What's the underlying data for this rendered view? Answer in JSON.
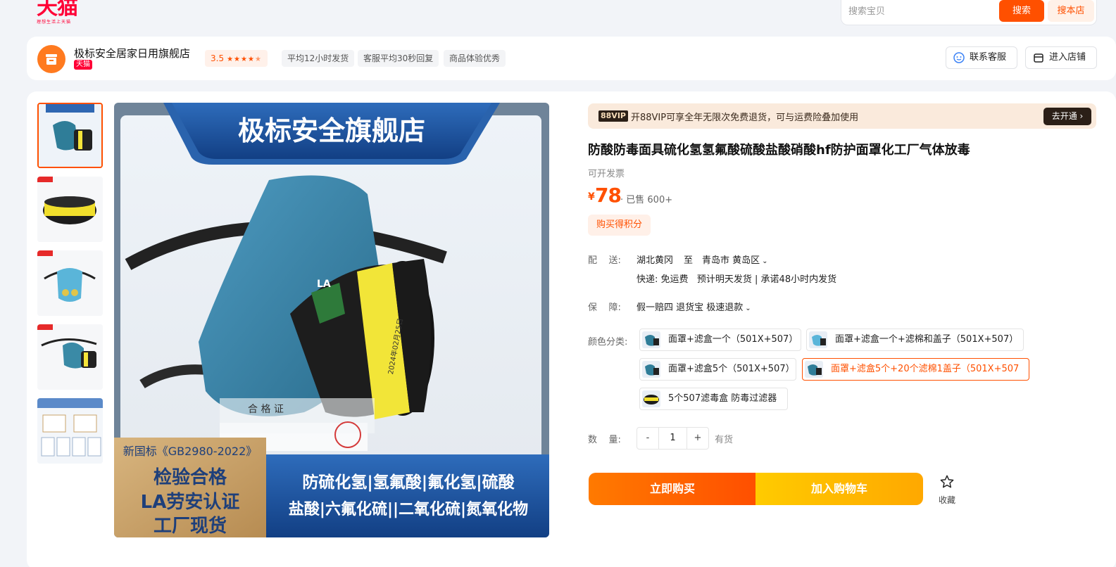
{
  "brand": {
    "logo_text": "天猫",
    "logo_slogan": "理想生活上天猫"
  },
  "search": {
    "placeholder": "搜索宝贝",
    "search_label": "搜索",
    "store_search_label": "搜本店"
  },
  "store": {
    "name": "极标安全居家日用旗舰店",
    "tag": "天猫",
    "rating": "3.5",
    "rating_stars": 3.5,
    "chips": [
      "平均12小时发货",
      "客服平均30秒回复",
      "商品体验优秀"
    ],
    "contact_label": "联系客服",
    "enter_label": "进入店铺"
  },
  "gallery": {
    "main_banner_title": "极标安全旗舰店",
    "badge_line1": "新国标《GB2980-2022》",
    "badge_line2": "检验合格",
    "badge_line3": "LA劳安认证",
    "badge_line4": "工厂现货",
    "footer_line1": "防硫化氢|氢氟酸|氟化氢|硫酸",
    "footer_line2": "盐酸|六氟化硫||二氧化硫|氮氧化物",
    "cert_label": "合 格 证",
    "filter_print": "2024年02月25日"
  },
  "vip": {
    "badge": "88VIP",
    "text": "开88VIP可享全年无限次免费退货，可与运费险叠加使用",
    "button": "去开通 ›"
  },
  "product": {
    "title": "防酸防毒面具硫化氢氢氟酸硫酸盐酸硝酸hf防护面罩化工厂气体放毒",
    "invoice": "可开发票",
    "price_symbol": "¥",
    "price": "78",
    "sold": "· 已售 600+",
    "points": "购买得积分"
  },
  "delivery": {
    "label": "配    送:",
    "from": "湖北黄冈",
    "to_word": "至",
    "to": "青岛市 黄岛区",
    "detail": "快递: 免运费   预计明天发货 | 承诺48小时内发货"
  },
  "guarantee": {
    "label": "保    障:",
    "value": "假一赔四 退货宝 极速退款"
  },
  "sku": {
    "label": "颜色分类:",
    "options": [
      "面罩+滤盒一个（501X+507）",
      "面罩+滤盒一个+滤棉和盖子（501X+507）",
      "面罩+滤盒5个（501X+507）",
      "面罩+滤盒5个+20个滤棉1盖子（501X+507",
      "5个507滤毒盒 防毒过滤器"
    ],
    "selected_index": 3
  },
  "quantity": {
    "label": "数    量:",
    "minus": "-",
    "value": "1",
    "plus": "+",
    "stock": "有货"
  },
  "actions": {
    "buy": "立即购买",
    "cart": "加入购物车",
    "favorite": "收藏"
  }
}
